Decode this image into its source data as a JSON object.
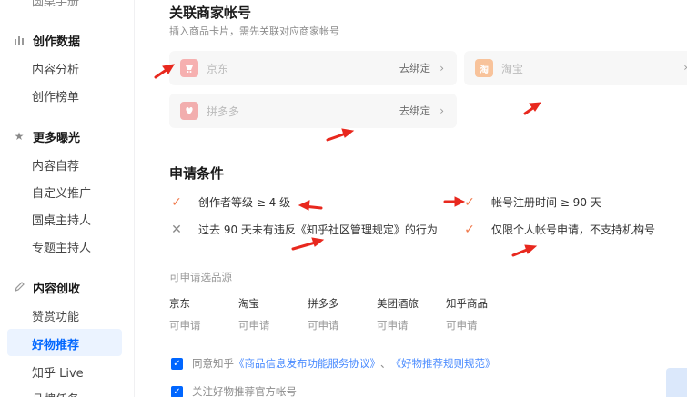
{
  "sidebar": {
    "cut_item": "圆桌手册",
    "sections": [
      {
        "icon": "bar-chart-icon",
        "title": "创作数据",
        "items": [
          "内容分析",
          "创作榜单"
        ]
      },
      {
        "icon": "star-icon",
        "title": "更多曝光",
        "items": [
          "内容自荐",
          "自定义推广",
          "圆桌主持人",
          "专题主持人"
        ]
      },
      {
        "icon": "pen-icon",
        "title": "内容创收",
        "items": [
          "赞赏功能",
          "好物推荐",
          "知乎 Live",
          "品牌任务"
        ]
      }
    ],
    "active_item": "好物推荐",
    "active_color": "#0066ff"
  },
  "bind": {
    "title": "关联商家帐号",
    "subtitle": "插入商品卡片，需先关联对应商家帐号",
    "shops": [
      {
        "name": "京东",
        "action": "去绑定",
        "logo_color": "#f5a3a3",
        "icon": "jd-logo-icon"
      },
      {
        "name": "淘宝",
        "action": "",
        "logo_color": "#f7b98a",
        "icon": "taobao-logo-icon"
      },
      {
        "name": "拼多多",
        "action": "去绑定",
        "logo_color": "#f0a0a0",
        "icon": "pinduoduo-logo-icon"
      }
    ]
  },
  "conditions": {
    "title": "申请条件",
    "items": [
      {
        "text": "创作者等级 ≥ 4 级",
        "met": true
      },
      {
        "text": "帐号注册时间 ≥ 90 天",
        "met": true
      },
      {
        "text": "过去 90 天未有违反《知乎社区管理规定》的行为",
        "met": false
      },
      {
        "text": "仅限个人帐号申请，不支持机构号",
        "met": true
      }
    ],
    "ok_color": "#f0784a"
  },
  "sources": {
    "title": "可申请选品源",
    "items": [
      {
        "name": "京东",
        "status": "可申请"
      },
      {
        "name": "淘宝",
        "status": "可申请"
      },
      {
        "name": "拼多多",
        "status": "可申请"
      },
      {
        "name": "美团酒旅",
        "status": "可申请"
      },
      {
        "name": "知乎商品",
        "status": "可申请"
      }
    ]
  },
  "agreements": {
    "first_prefix": "同意知乎",
    "first_link1": "《商品信息发布功能服务协议》",
    "first_sep": "、",
    "first_link2": "《好物推荐规则规范》",
    "second": "关注好物推荐官方帐号"
  },
  "annotation_color": "#e8281e"
}
